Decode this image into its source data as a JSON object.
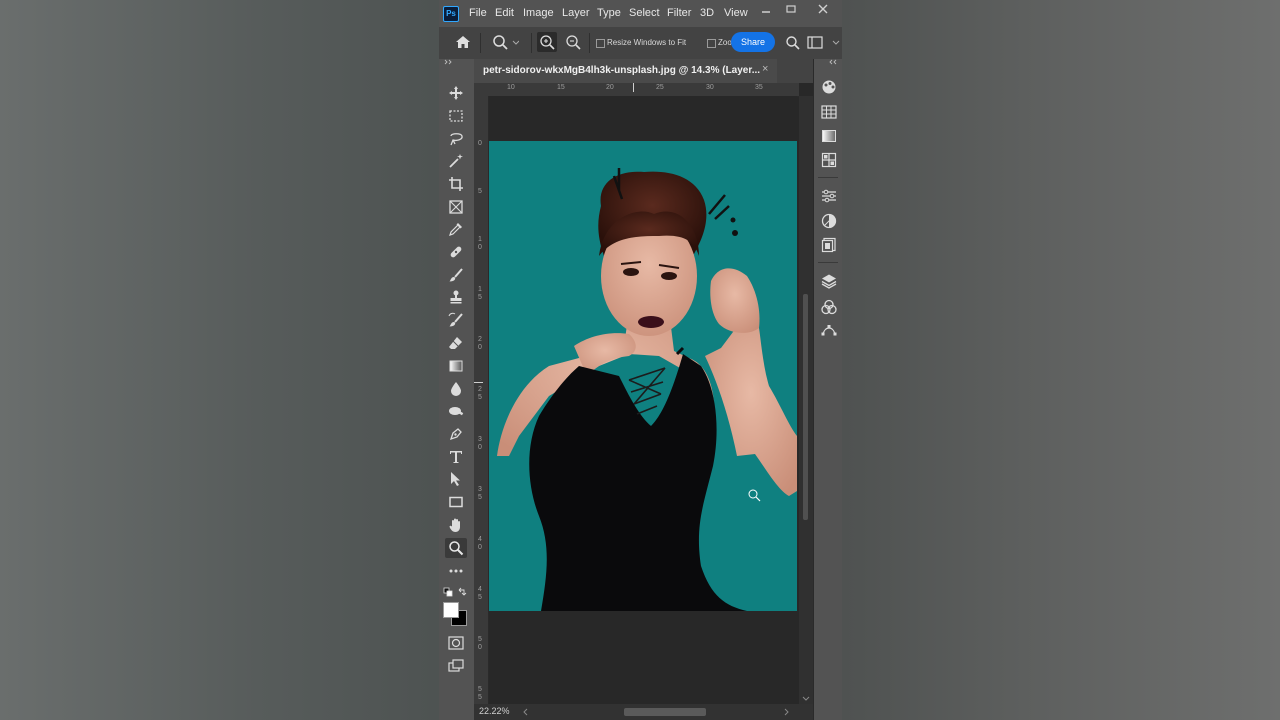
{
  "app": {
    "logo": "Ps",
    "menu": [
      "File",
      "Edit",
      "Image",
      "Layer",
      "Type",
      "Select",
      "Filter",
      "3D",
      "View"
    ]
  },
  "options": {
    "resize_windows_label": "Resize Windows to Fit",
    "zoom_all_label": "Zoo",
    "share_label": "Share"
  },
  "document": {
    "tab_title": "petr-sidorov-wkxMgB4lh3k-unsplash.jpg @ 14.3% (Layer...",
    "close_glyph": "×",
    "zoom_status": "22.22%",
    "background_color": "#0f8080"
  },
  "rulers": {
    "h_labels": [
      "10",
      "15",
      "20",
      "25",
      "30",
      "35"
    ],
    "v_labels": [
      "0",
      "5",
      "1 0",
      "1 5",
      "2 0",
      "2 5",
      "3 0",
      "3 5",
      "4 0",
      "4 5",
      "5 0",
      "5 5"
    ]
  },
  "tools": [
    "move-tool-icon",
    "marquee-tool-icon",
    "lasso-tool-icon",
    "magic-wand-icon",
    "crop-tool-icon",
    "frame-tool-icon",
    "eyedropper-icon",
    "healing-brush-icon",
    "brush-tool-icon",
    "clone-stamp-icon",
    "history-brush-icon",
    "eraser-icon",
    "gradient-tool-icon",
    "blur-tool-icon",
    "dodge-tool-icon",
    "pen-tool-icon",
    "type-tool-icon",
    "path-selection-icon",
    "rectangle-tool-icon",
    "hand-tool-icon",
    "zoom-tool-icon",
    "more-tools-icon"
  ],
  "right_panel": [
    "color-panel-icon",
    "swatches-icon",
    "gradients-icon",
    "patterns-icon",
    "properties-icon",
    "adjustments-icon",
    "libraries-icon",
    "layers-icon",
    "channels-icon",
    "paths-icon"
  ],
  "colors": {
    "accent": "#1473e6",
    "teal": "#0f8080"
  }
}
